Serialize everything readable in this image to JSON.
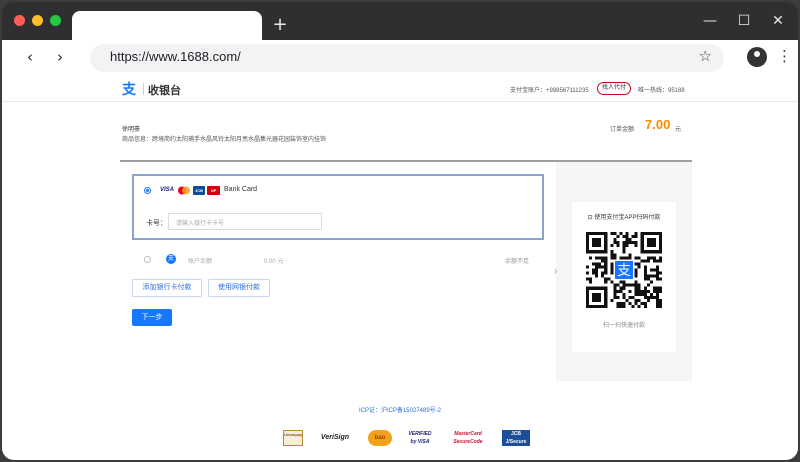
{
  "browser": {
    "new_tab_symbol": "+",
    "url": "https://www.1688.com/",
    "window_controls": {
      "minimize": "—",
      "maximize": "☐",
      "close": "✕"
    },
    "nav": {
      "back": "‹",
      "forward": "›"
    },
    "star": "☆",
    "menu": "⋮"
  },
  "header": {
    "logo_glyph": "支",
    "title": "收银台",
    "account": "支付宝账户：+998567111235",
    "proxy_button": "找人代付",
    "hotline": "唯一热线：95188"
  },
  "order": {
    "payee": "徐明豪",
    "goods": "商品信息：跨境简约太阳捕手水晶风铃太阳月亮水晶集光器花园装饰室内挂饰",
    "amount_label": "订单金额",
    "amount": "7.00",
    "unit": "元"
  },
  "payment": {
    "card_brands": [
      "VISA",
      "MC",
      "JCB",
      "UP"
    ],
    "bank_card_label": "Bank Card",
    "card_number_label": "卡号：",
    "card_number_placeholder": "请输入银行卡卡号",
    "balance_label": "账户余额",
    "balance_amount": "0.00 元",
    "balance_status": "余额不足",
    "add_card_button": "添加银行卡付款",
    "netbank_button": "使用网银付款",
    "next_button": "下一步",
    "collapse_arrow": "›"
  },
  "qr": {
    "title": "使用支付宝APP扫码付款",
    "caption": "扫一扫快速付款",
    "center_glyph": "支"
  },
  "footer": {
    "icp": "ICP证：沪ICP备15027489号-2",
    "badges": [
      "Unionpay",
      "VeriSign",
      "bao",
      "VERIFIED by VISA",
      "MasterCard SecureCode",
      "JCB J/Secure"
    ]
  },
  "colors": {
    "accent": "#1677ff",
    "amount": "#ff8800",
    "proxy_border": "#d0021b"
  }
}
